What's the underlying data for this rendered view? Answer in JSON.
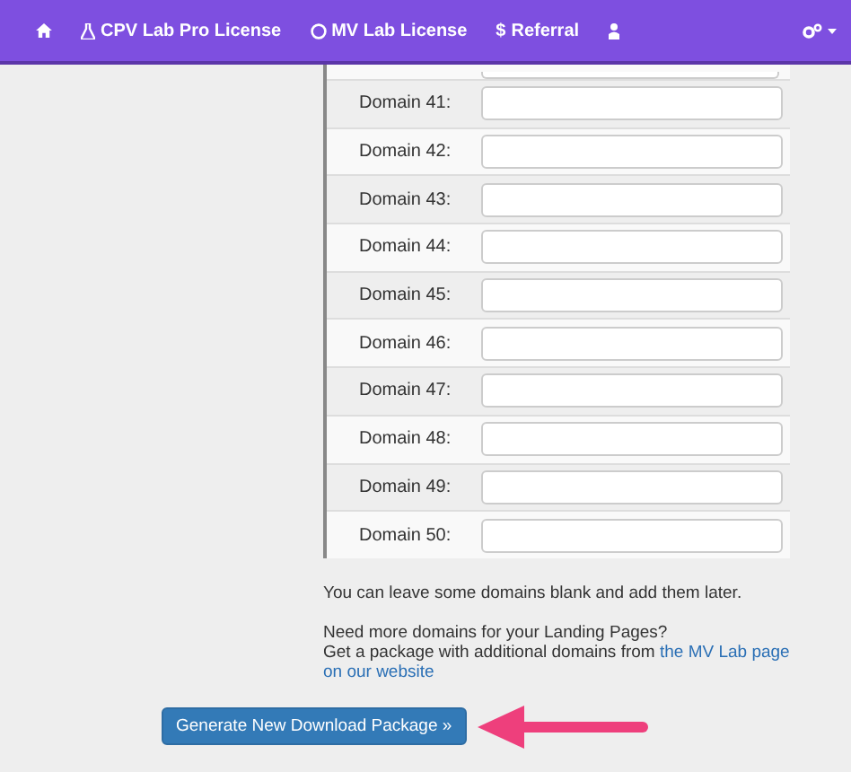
{
  "navbar": {
    "items": [
      {
        "kind": "home"
      },
      {
        "kind": "flask",
        "label": "CPV Lab Pro License"
      },
      {
        "kind": "circle",
        "label": "MV Lab License"
      },
      {
        "kind": "dollar",
        "glyph": "$",
        "label": "Referral"
      },
      {
        "kind": "user"
      }
    ]
  },
  "domains": [
    {
      "label": "Domain 41:"
    },
    {
      "label": "Domain 42:"
    },
    {
      "label": "Domain 43:"
    },
    {
      "label": "Domain 44:"
    },
    {
      "label": "Domain 45:"
    },
    {
      "label": "Domain 46:"
    },
    {
      "label": "Domain 47:"
    },
    {
      "label": "Domain 48:"
    },
    {
      "label": "Domain 49:"
    },
    {
      "label": "Domain 50:"
    }
  ],
  "note": "You can leave some domains blank and add them later.",
  "more_domains": {
    "question": "Need more domains for your Landing Pages?",
    "text": "Get a package with additional domains from ",
    "link_lines": [
      "the MV Lab page",
      "on our website"
    ]
  },
  "button": "Generate New Download Package »"
}
